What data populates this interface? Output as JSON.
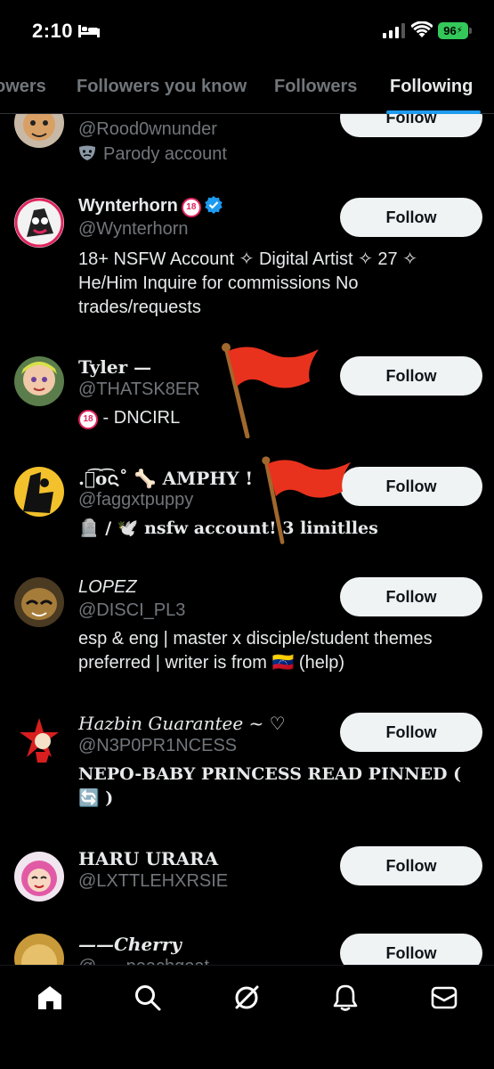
{
  "status_bar": {
    "time": "2:10",
    "battery": "96"
  },
  "tabs": [
    {
      "label": "owers"
    },
    {
      "label": "Followers you know"
    },
    {
      "label": "Followers"
    },
    {
      "label": "Following"
    }
  ],
  "follow_label": "Follow",
  "users": [
    {
      "name": "",
      "handle": "@Rood0wnunder",
      "bio": "Parody account",
      "bio_icon": "theater-mask-icon"
    },
    {
      "name": "Wynterhorn",
      "badge18": "18",
      "verified": true,
      "handle": "@Wynterhorn",
      "bio": "18+ NSFW Account ✧ Digital Artist ✧ 27 ✧ He/Him Inquire for commissions No trades/requests"
    },
    {
      "name": "Tyler —",
      "handle": "@THATSK8ER",
      "badge18": "18",
      "bio": " - DNCIRL"
    },
    {
      "name": ".ᨶ͡o͡ᨶ˚ 🦴 AMPHY !",
      "handle": "@faggxtpuppy",
      "bio": "🪦 / 🕊️ nsfw account! 3 limitlles"
    },
    {
      "name": "LOPEZ",
      "handle": "@DISCI_PL3",
      "bio": "esp & eng | master x disciple/student themes preferred | writer is from 🇻🇪 (help)"
    },
    {
      "name": "Hazbin Guarantee ~ ♡",
      "handle": "@N3P0PR1NCESS",
      "bio": " NEPO-BABY PRINCESS READ PINNED ( 🔄 )"
    },
    {
      "name": "HARU URARA",
      "handle": "@LXTTLEHXRSIE",
      "bio": ""
    },
    {
      "name": "——Cherry",
      "handle": "@___peachgoat",
      "bio": ""
    }
  ],
  "nav": [
    "home-icon",
    "search-icon",
    "grok-icon",
    "notifications-icon",
    "messages-icon"
  ],
  "colors": {
    "accent": "#1d9bf0",
    "button_bg": "#eff3f4",
    "muted": "#71767b",
    "battery": "#34c759",
    "flag": "#e8321e"
  }
}
